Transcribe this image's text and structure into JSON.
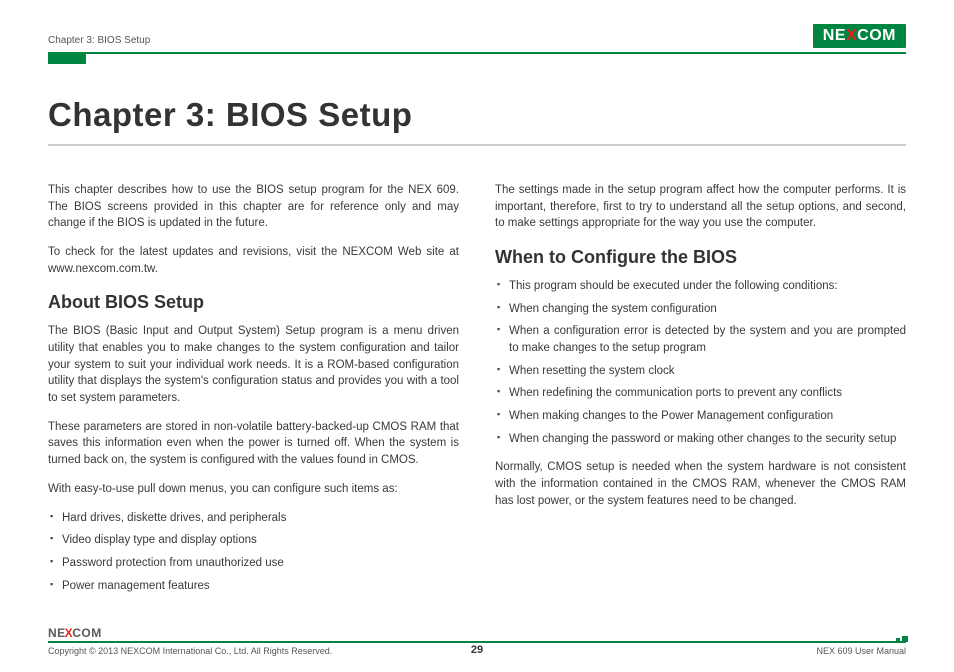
{
  "header": {
    "running_head": "Chapter 3: BIOS Setup",
    "logo_left": "NE",
    "logo_x": "X",
    "logo_right": "COM"
  },
  "title": "Chapter 3: BIOS Setup",
  "left": {
    "intro1": "This chapter describes how to use the BIOS setup program for the NEX 609. The BIOS screens provided in this chapter are for reference only and may change if the BIOS is updated in the future.",
    "intro2": "To check for the latest updates and revisions, visit the NEXCOM Web site at www.nexcom.com.tw.",
    "h2": "About BIOS Setup",
    "p1": "The BIOS (Basic Input and Output System) Setup program is a menu driven utility that enables you to make changes to the system configuration and tailor your system to suit your individual work needs. It is a ROM-based configuration utility that displays the system's configuration status and provides you with a tool to set system parameters.",
    "p2": "These parameters are stored in non-volatile battery-backed-up CMOS RAM that saves this information even when the power is turned off. When the system is turned back on, the system is configured with the values found in CMOS.",
    "p3": "With easy-to-use pull down menus, you can configure such items as:",
    "bullets": [
      "Hard drives, diskette drives, and peripherals",
      "Video display type and display options",
      "Password protection from unauthorized use",
      "Power management features"
    ]
  },
  "right": {
    "intro": "The settings made in the setup program affect how the computer performs. It is important, therefore, first to try to understand all the setup options, and second, to make settings appropriate for the way you use the computer.",
    "h2": "When to Configure the BIOS",
    "bullets": [
      "This program should be executed under the following conditions:",
      "When changing the system configuration",
      "When a configuration error is detected by the system and you are prompted to make changes to the setup program",
      "When resetting the system clock",
      "When redefining the communication ports to prevent any conflicts",
      "When making changes to the Power Management configuration",
      "When changing the password or making other changes to the security setup"
    ],
    "outro": "Normally, CMOS setup is needed when the system hardware is not consistent with the information contained in the CMOS RAM, whenever the CMOS RAM has lost power, or the system features need to be changed."
  },
  "footer": {
    "logo_left": "NE",
    "logo_x": "X",
    "logo_right": "COM",
    "copyright": "Copyright © 2013 NEXCOM International Co., Ltd. All Rights Reserved.",
    "page": "29",
    "manual": "NEX 609 User Manual"
  }
}
